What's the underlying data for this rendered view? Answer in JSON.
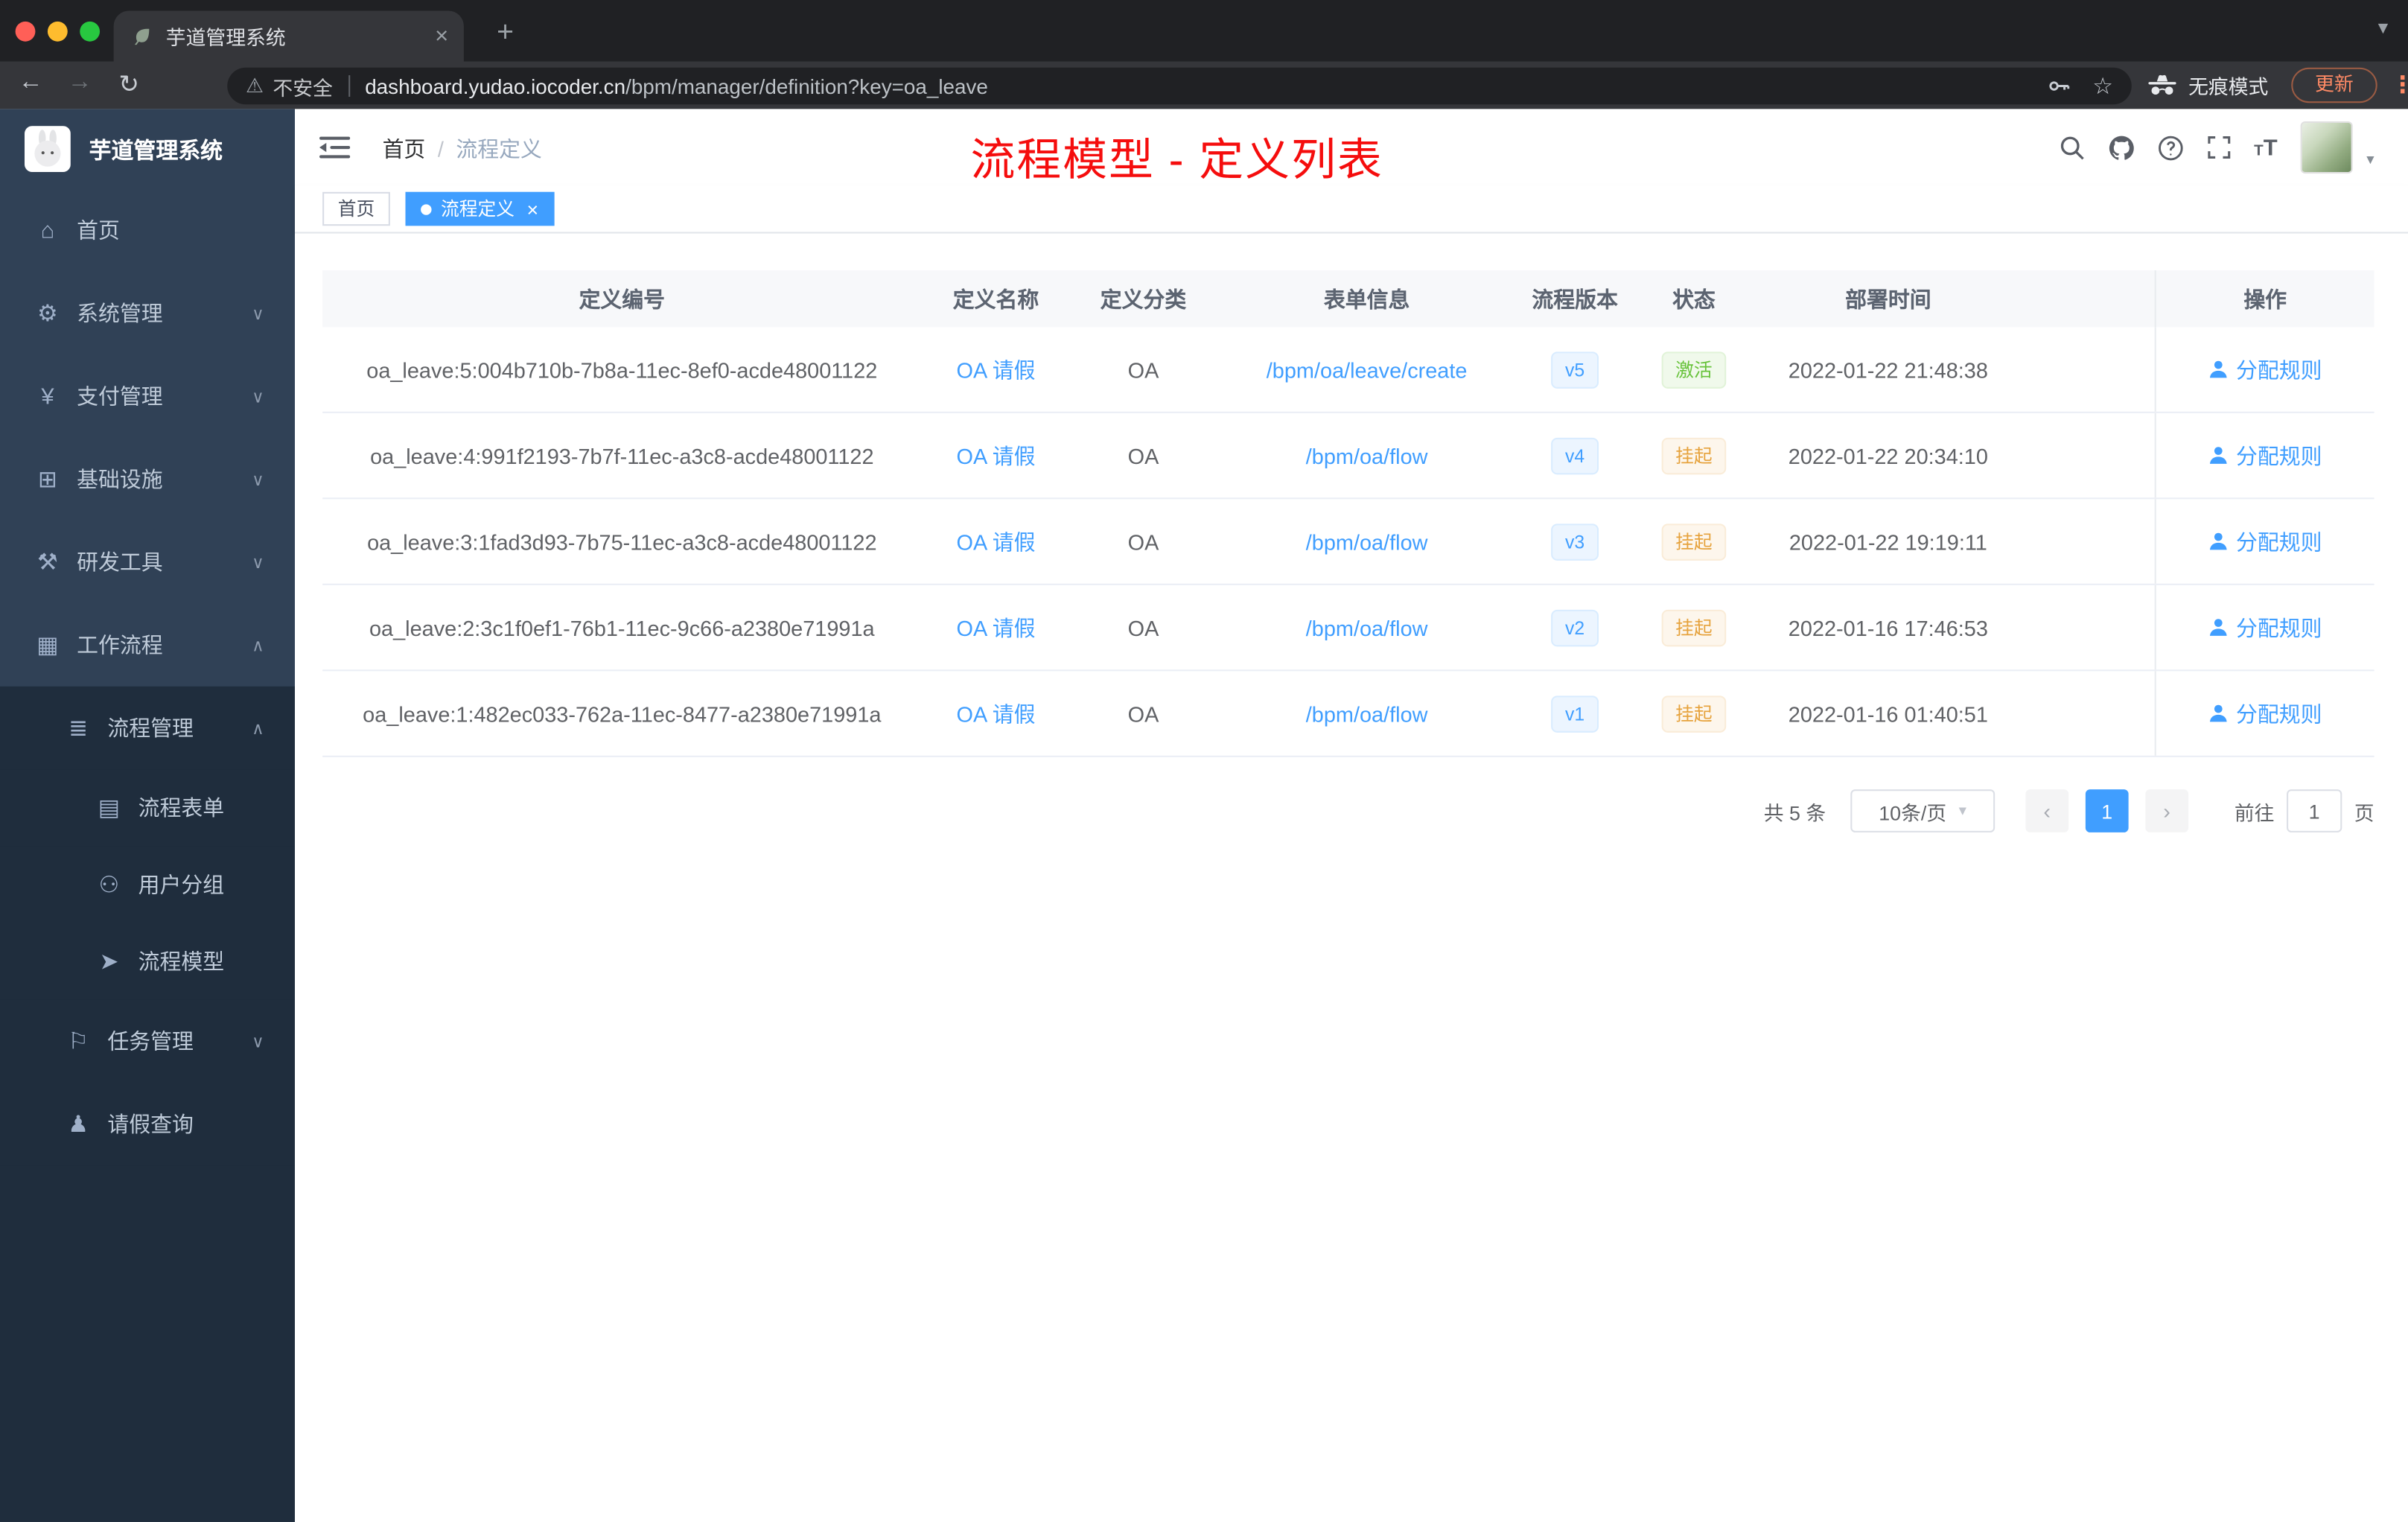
{
  "browser": {
    "tab_title": "芋道管理系统",
    "security_label": "不安全",
    "url_domain": "dashboard.yudao.iocoder.cn",
    "url_path": "/bpm/manager/definition?key=oa_leave",
    "incognito_label": "无痕模式",
    "update_label": "更新"
  },
  "sidebar": {
    "app_title": "芋道管理系统",
    "items": [
      {
        "label": "首页",
        "icon": "dashboard-icon"
      },
      {
        "label": "系统管理",
        "icon": "gear-icon"
      },
      {
        "label": "支付管理",
        "icon": "yen-icon"
      },
      {
        "label": "基础设施",
        "icon": "grid-icon"
      },
      {
        "label": "研发工具",
        "icon": "tools-icon"
      },
      {
        "label": "工作流程",
        "icon": "workflow-icon"
      },
      {
        "label": "流程管理",
        "icon": "list-icon"
      },
      {
        "label": "流程表单",
        "icon": "form-icon"
      },
      {
        "label": "用户分组",
        "icon": "users-icon"
      },
      {
        "label": "流程模型",
        "icon": "send-icon"
      },
      {
        "label": "任务管理",
        "icon": "flag-icon"
      },
      {
        "label": "请假查询",
        "icon": "person-icon"
      }
    ]
  },
  "header": {
    "breadcrumb_home": "首页",
    "breadcrumb_separator": "/",
    "breadcrumb_current": "流程定义",
    "annotation": "流程模型 - 定义列表"
  },
  "tags": {
    "home": "首页",
    "active": "流程定义"
  },
  "table": {
    "columns": [
      "定义编号",
      "定义名称",
      "定义分类",
      "表单信息",
      "流程版本",
      "状态",
      "部署时间",
      "操作"
    ],
    "rows": [
      {
        "id": "oa_leave:5:004b710b-7b8a-11ec-8ef0-acde48001122",
        "name": "OA 请假",
        "category": "OA",
        "form": "/bpm/oa/leave/create",
        "version": "v5",
        "status": "激活",
        "time": "2022-01-22 21:48:38",
        "action": "分配规则"
      },
      {
        "id": "oa_leave:4:991f2193-7b7f-11ec-a3c8-acde48001122",
        "name": "OA 请假",
        "category": "OA",
        "form": "/bpm/oa/flow",
        "version": "v4",
        "status": "挂起",
        "time": "2022-01-22 20:34:10",
        "action": "分配规则"
      },
      {
        "id": "oa_leave:3:1fad3d93-7b75-11ec-a3c8-acde48001122",
        "name": "OA 请假",
        "category": "OA",
        "form": "/bpm/oa/flow",
        "version": "v3",
        "status": "挂起",
        "time": "2022-01-22 19:19:11",
        "action": "分配规则"
      },
      {
        "id": "oa_leave:2:3c1f0ef1-76b1-11ec-9c66-a2380e71991a",
        "name": "OA 请假",
        "category": "OA",
        "form": "/bpm/oa/flow",
        "version": "v2",
        "status": "挂起",
        "time": "2022-01-16 17:46:53",
        "action": "分配规则"
      },
      {
        "id": "oa_leave:1:482ec033-762a-11ec-8477-a2380e71991a",
        "name": "OA 请假",
        "category": "OA",
        "form": "/bpm/oa/flow",
        "version": "v1",
        "status": "挂起",
        "time": "2022-01-16 01:40:51",
        "action": "分配规则"
      }
    ]
  },
  "pagination": {
    "total": "共 5 条",
    "page_size": "10条/页",
    "current_page": "1",
    "goto_label": "前往",
    "goto_value": "1",
    "page_unit": "页"
  }
}
